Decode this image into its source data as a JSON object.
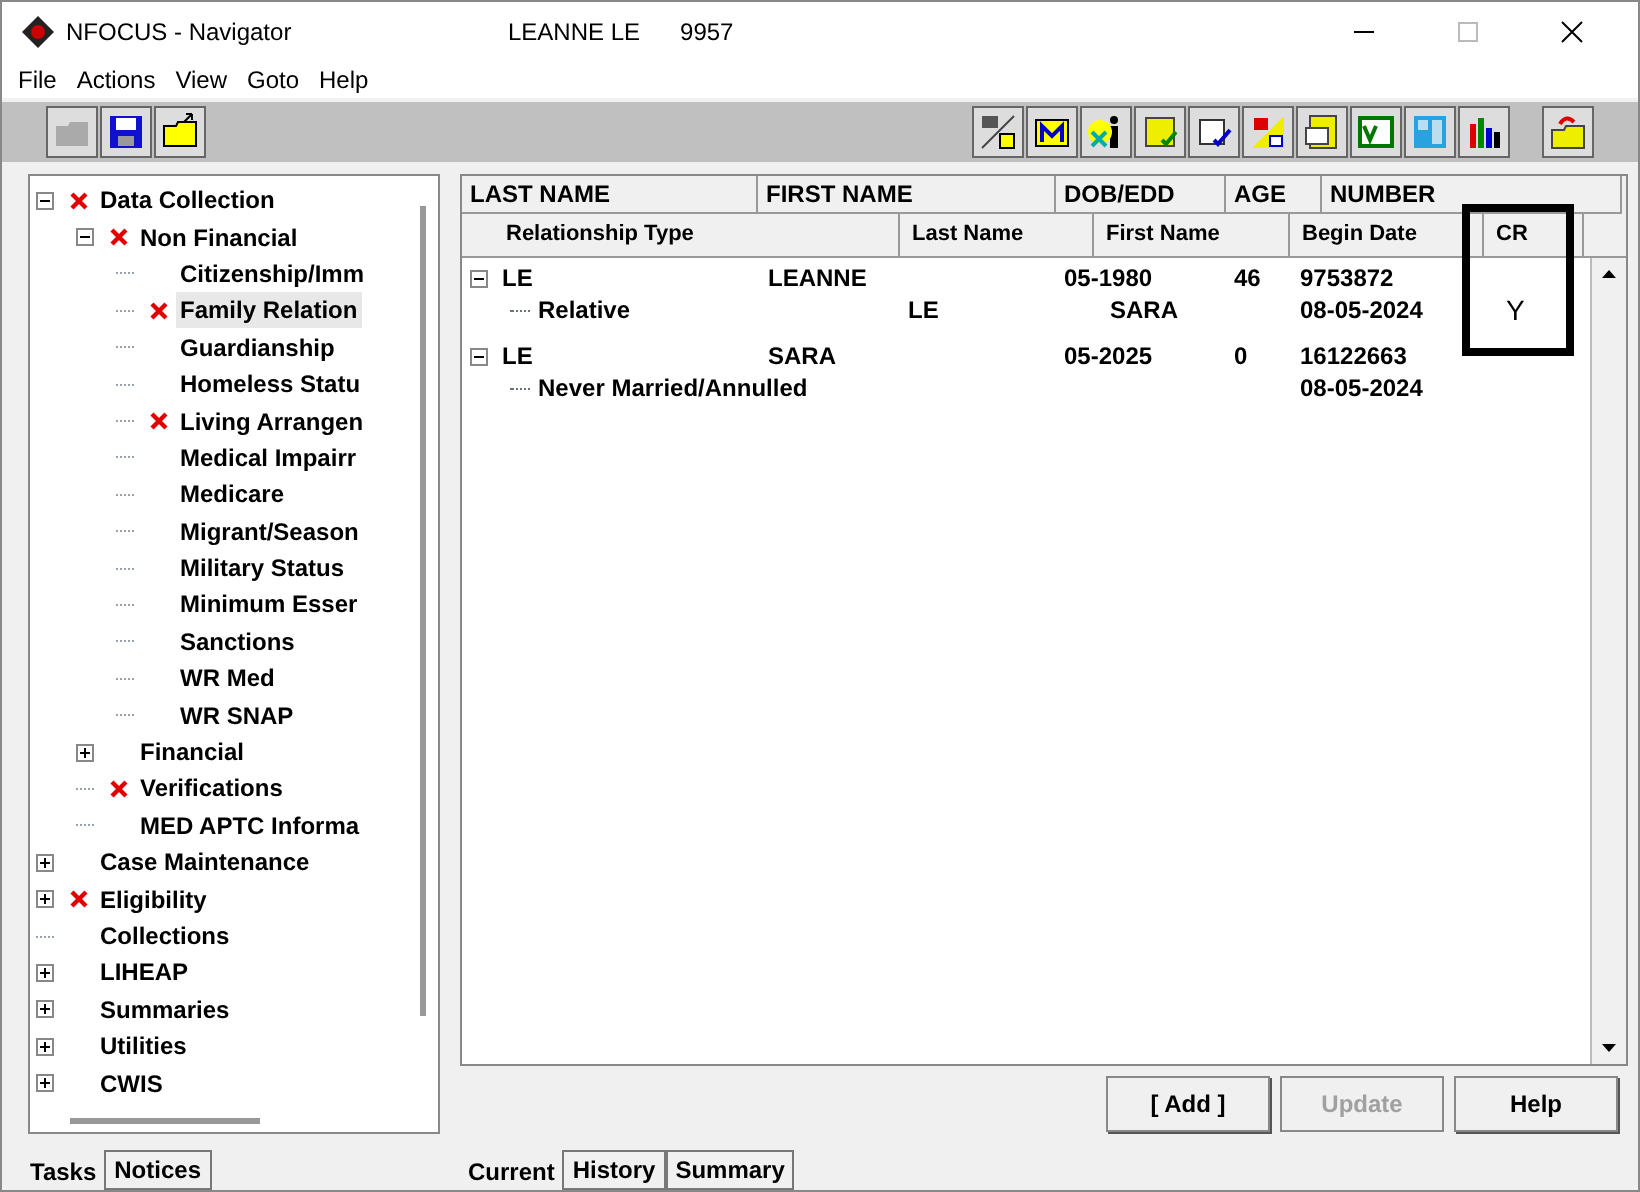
{
  "window": {
    "title": "NFOCUS - Navigator",
    "case_name": "LEANNE LE",
    "case_number": "9957"
  },
  "menu": [
    "File",
    "Actions",
    "View",
    "Goto",
    "Help"
  ],
  "tree": [
    {
      "label": "Data Collection",
      "flagged": true,
      "expanded": true,
      "selected": false,
      "children": [
        {
          "label": "Non Financial",
          "flagged": true,
          "expanded": true,
          "selected": false,
          "children": [
            {
              "label": "Citizenship/Imm",
              "flagged": false,
              "selected": false
            },
            {
              "label": "Family Relation",
              "flagged": true,
              "selected": true
            },
            {
              "label": "Guardianship",
              "flagged": false,
              "selected": false
            },
            {
              "label": "Homeless Statu",
              "flagged": false,
              "selected": false
            },
            {
              "label": "Living Arrangen",
              "flagged": true,
              "selected": false
            },
            {
              "label": "Medical Impairr",
              "flagged": false,
              "selected": false
            },
            {
              "label": "Medicare",
              "flagged": false,
              "selected": false
            },
            {
              "label": "Migrant/Season",
              "flagged": false,
              "selected": false
            },
            {
              "label": "Military Status",
              "flagged": false,
              "selected": false
            },
            {
              "label": "Minimum Esser",
              "flagged": false,
              "selected": false
            },
            {
              "label": "Sanctions",
              "flagged": false,
              "selected": false
            },
            {
              "label": "WR Med",
              "flagged": false,
              "selected": false
            },
            {
              "label": "WR SNAP",
              "flagged": false,
              "selected": false
            }
          ]
        },
        {
          "label": "Financial",
          "flagged": false,
          "expanded": false,
          "selected": false
        },
        {
          "label": "Verifications",
          "flagged": true,
          "selected": false
        },
        {
          "label": "MED APTC Informa",
          "flagged": false,
          "selected": false
        }
      ]
    },
    {
      "label": "Case Maintenance",
      "flagged": false,
      "expanded": false,
      "selected": false
    },
    {
      "label": "Eligibility",
      "flagged": true,
      "expanded": false,
      "selected": false
    },
    {
      "label": "Collections",
      "flagged": false,
      "selected": false
    },
    {
      "label": "LIHEAP",
      "flagged": false,
      "expanded": false,
      "selected": false
    },
    {
      "label": "Summaries",
      "flagged": false,
      "expanded": false,
      "selected": false
    },
    {
      "label": "Utilities",
      "flagged": false,
      "expanded": false,
      "selected": false
    },
    {
      "label": "CWIS",
      "flagged": false,
      "expanded": false,
      "selected": false
    }
  ],
  "left_tabs": [
    {
      "label": "Tasks",
      "selected": true
    },
    {
      "label": "Notices",
      "selected": false
    }
  ],
  "grid": {
    "person_columns": [
      "LAST NAME",
      "FIRST NAME",
      "DOB/EDD",
      "AGE",
      "NUMBER"
    ],
    "relationship_columns": [
      "Relationship Type",
      "Last Name",
      "First Name",
      "Begin Date",
      "CR"
    ],
    "people": [
      {
        "last_name": "LE",
        "first_name": "LEANNE",
        "dob": "05-1980",
        "age": "46",
        "number": "9753872",
        "relationships": [
          {
            "type": "Relative",
            "last_name": "LE",
            "first_name": "SARA",
            "begin_date": "08-05-2024",
            "cr": "Y"
          }
        ]
      },
      {
        "last_name": "LE",
        "first_name": "SARA",
        "dob": "05-2025",
        "age": "0",
        "number": "16122663",
        "relationships": [
          {
            "type": "Never Married/Annulled",
            "begin_date": "08-05-2024"
          }
        ]
      }
    ]
  },
  "buttons": [
    {
      "label": "[ Add ]",
      "disabled": false
    },
    {
      "label": "Update",
      "disabled": true
    },
    {
      "label": "Help",
      "disabled": false
    }
  ],
  "bottom_tabs": [
    {
      "label": "Current",
      "selected": true
    },
    {
      "label": "History",
      "selected": false
    },
    {
      "label": "Summary",
      "selected": false
    }
  ]
}
